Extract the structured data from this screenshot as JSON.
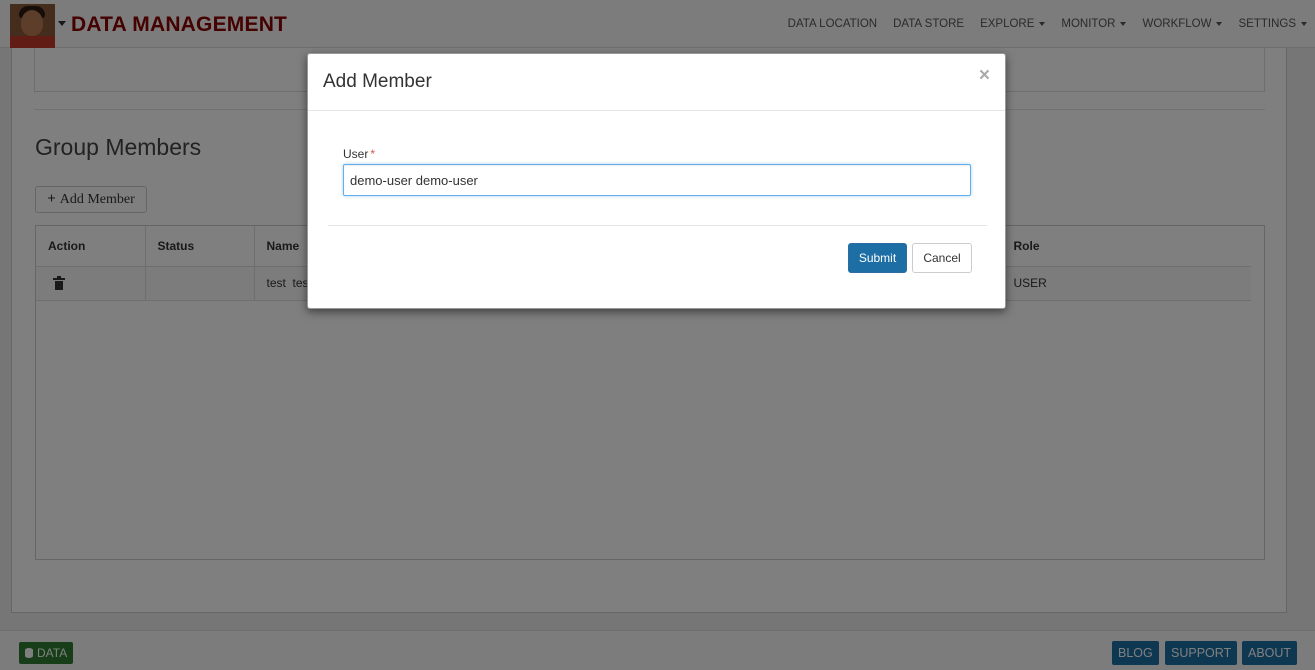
{
  "header": {
    "brand": "DATA MANAGEMENT",
    "nav": [
      {
        "label": "DATA LOCATION",
        "dropdown": false
      },
      {
        "label": "DATA STORE",
        "dropdown": false
      },
      {
        "label": "EXPLORE",
        "dropdown": true
      },
      {
        "label": "MONITOR",
        "dropdown": true
      },
      {
        "label": "WORKFLOW",
        "dropdown": true
      },
      {
        "label": "SETTINGS",
        "dropdown": true
      }
    ]
  },
  "main": {
    "section_title": "Group Members",
    "add_member_label": "Add Member",
    "table": {
      "columns": [
        "Action",
        "Status",
        "Name",
        "Role"
      ],
      "rows": [
        {
          "status": "",
          "name": "test  test",
          "role": "USER"
        }
      ]
    }
  },
  "footer": {
    "data_label": "DATA",
    "links": [
      "BLOG",
      "SUPPORT",
      "ABOUT"
    ]
  },
  "modal": {
    "title": "Add Member",
    "close_glyph": "×",
    "field_label": "User",
    "required_mark": "*",
    "user_value": "demo-user demo-user",
    "submit_label": "Submit",
    "cancel_label": "Cancel"
  },
  "colors": {
    "brand": "#8b0000",
    "primary": "#1c6ea4",
    "footer_data": "#2e7d32",
    "required": "#d9534f"
  }
}
